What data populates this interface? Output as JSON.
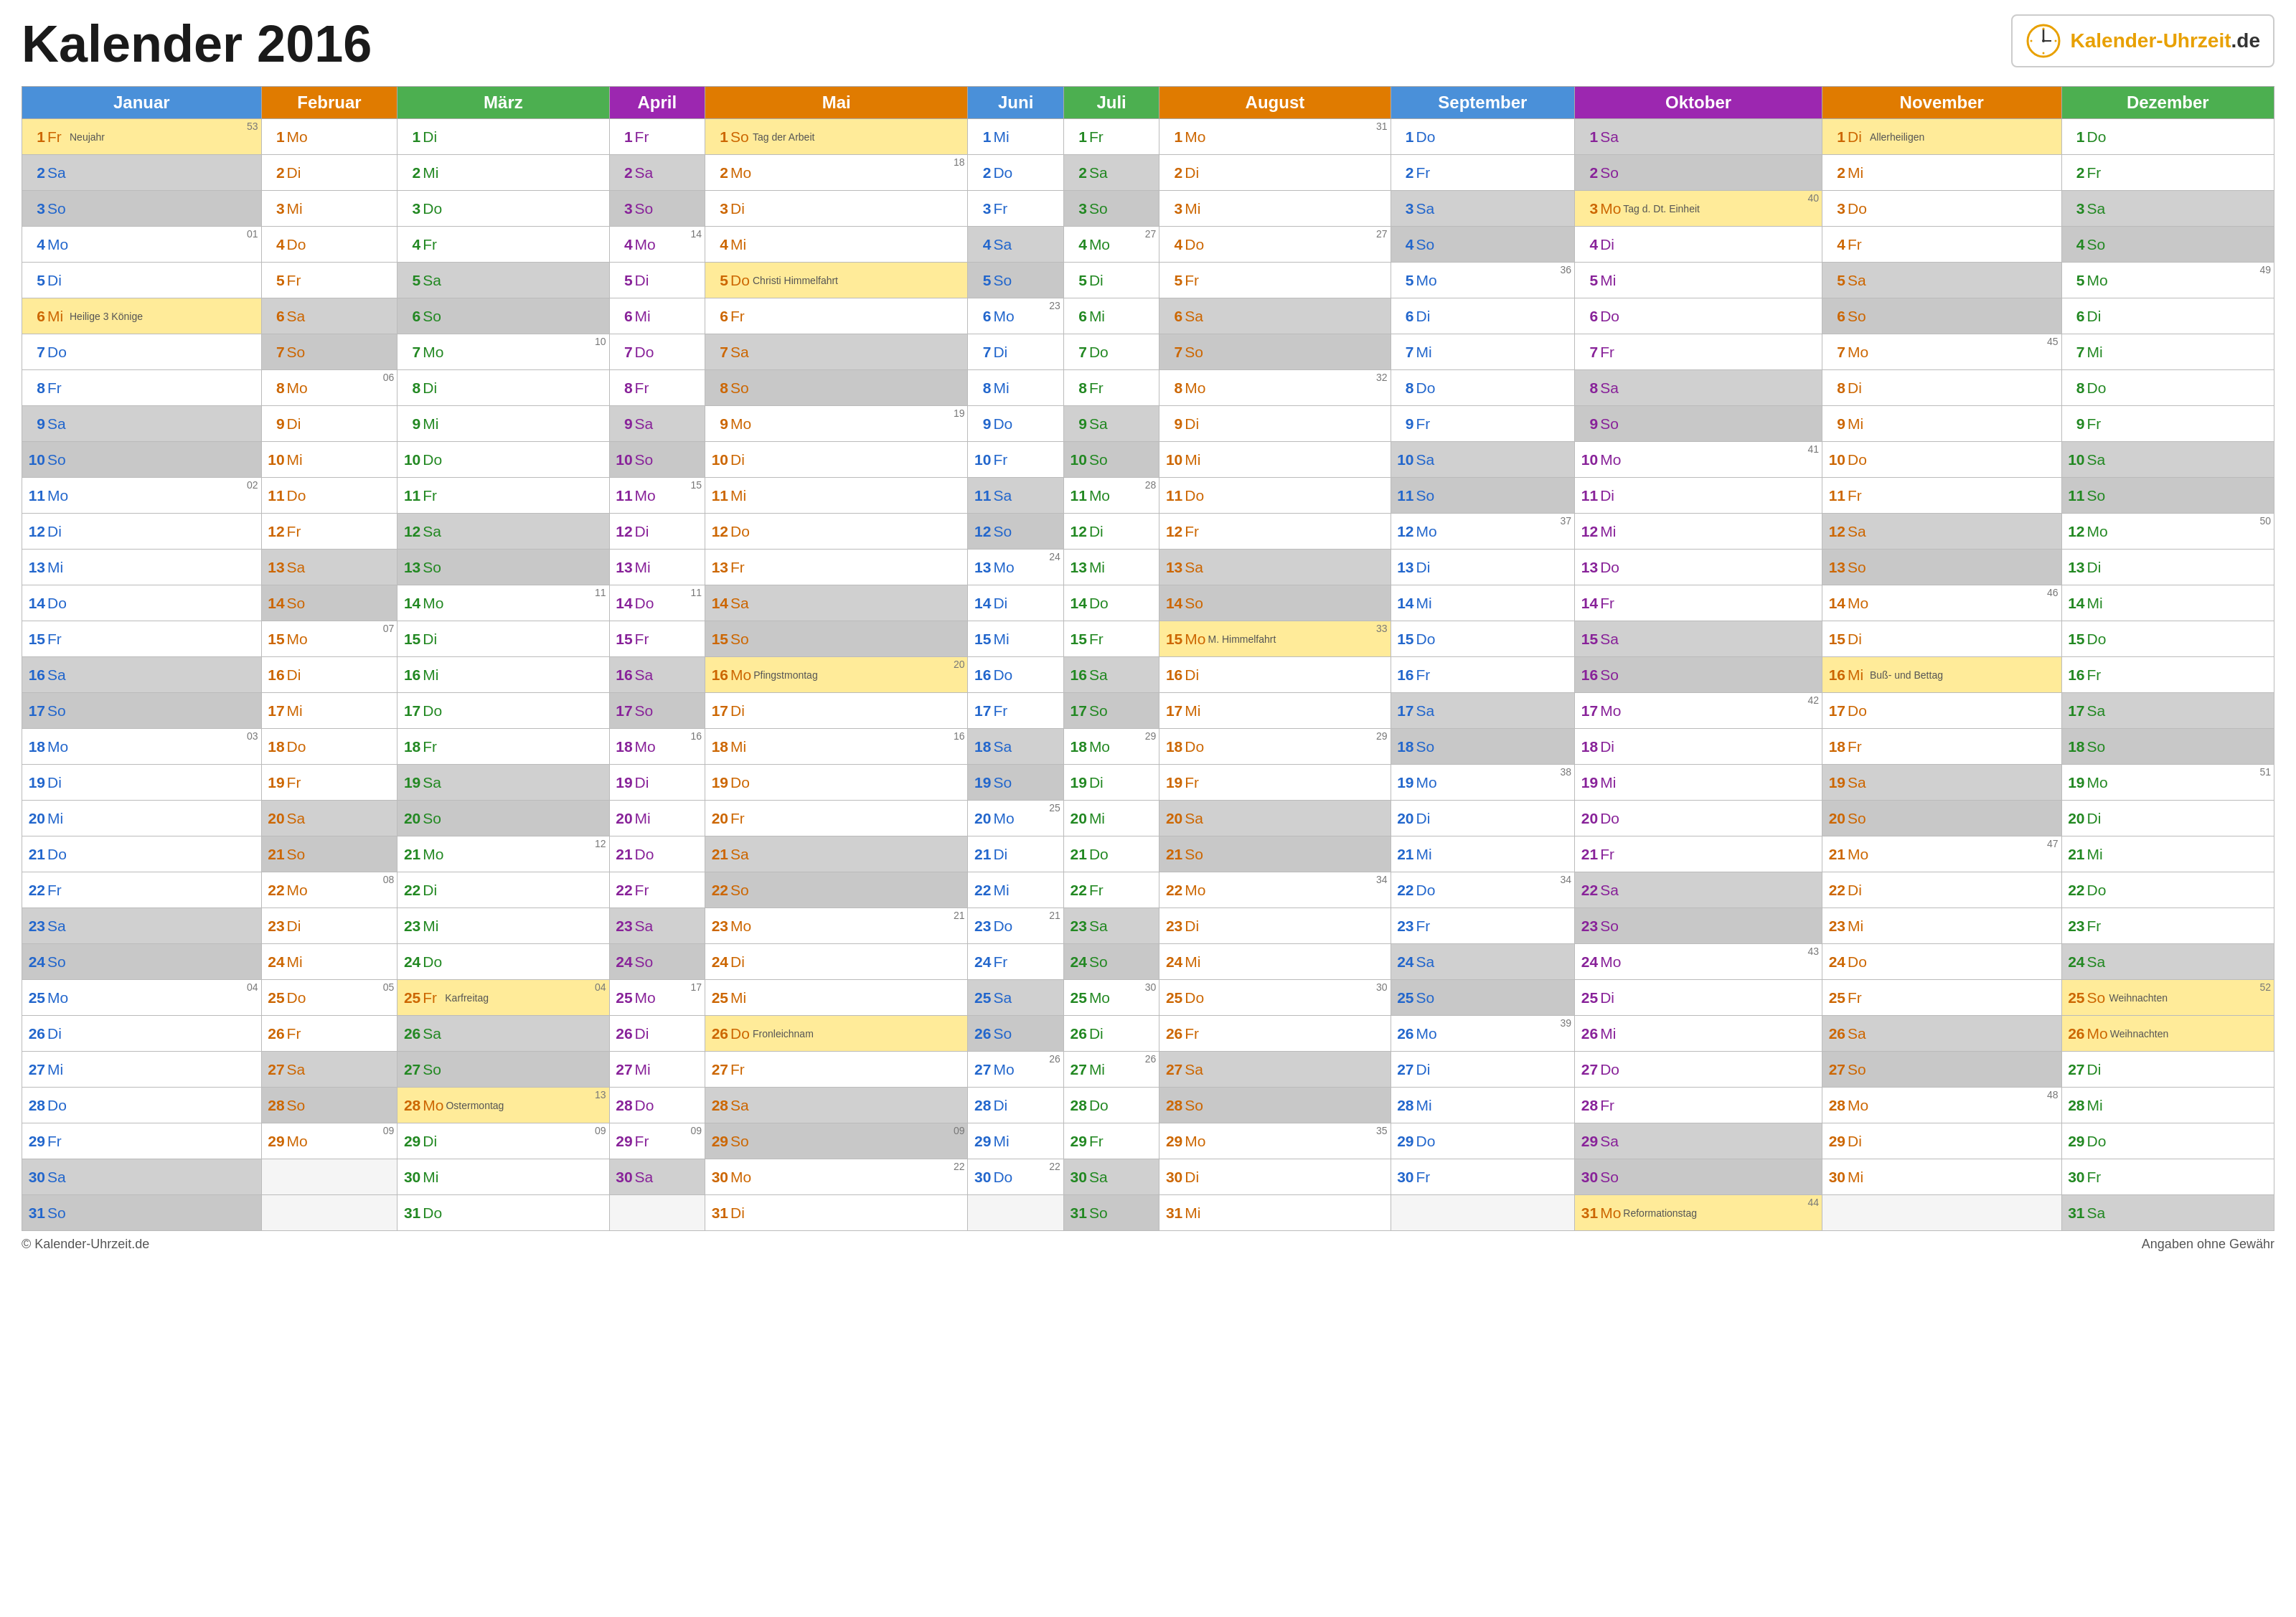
{
  "title": "Kalender 2016",
  "logo": {
    "text1": "Kalender-",
    "text2": "Uhrzeit",
    "text3": ".de"
  },
  "footer": {
    "website": "© Kalender-Uhrzeit.de",
    "disclaimer": "Angaben ohne Gewähr"
  },
  "months": [
    "Januar",
    "Februar",
    "März",
    "April",
    "Mai",
    "Juni",
    "Juli",
    "August",
    "September",
    "Oktober",
    "November",
    "Dezember"
  ]
}
